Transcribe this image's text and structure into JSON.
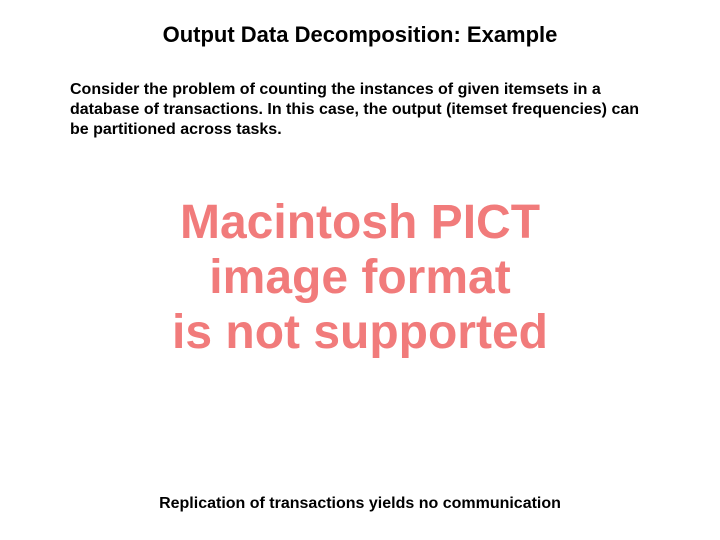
{
  "title": "Output Data Decomposition: Example",
  "body": "Consider the problem of counting the instances of given itemsets in a database of transactions. In this case, the output (itemset frequencies) can be partitioned across tasks.",
  "placeholder": {
    "line1": "Macintosh PICT",
    "line2": "image format",
    "line3": "is not supported"
  },
  "footer": "Replication of transactions yields no communication"
}
